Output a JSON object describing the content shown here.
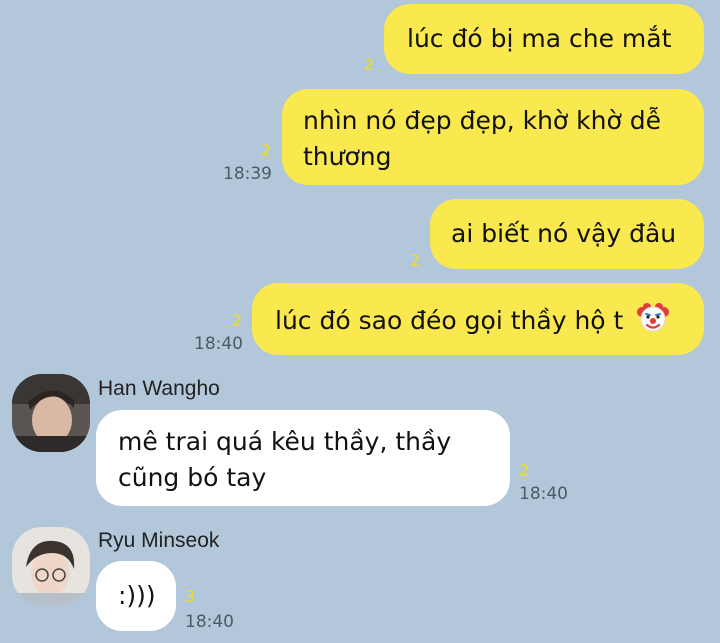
{
  "messages": [
    {
      "sender": "me",
      "text": "lúc đó bị ma che mắt",
      "unread": "2",
      "time": ""
    },
    {
      "sender": "me",
      "text_lines": [
        "nhìn nó đẹp đẹp, khờ khờ dễ",
        "thương"
      ],
      "unread": "2",
      "time": "18:39"
    },
    {
      "sender": "me",
      "text": "ai biết nó vậy đâu",
      "unread": "2",
      "time": ""
    },
    {
      "sender": "me",
      "text": "lúc đó sao đéo gọi thầy hộ t",
      "emoji": "clown-face",
      "unread": "2",
      "time": "18:40"
    },
    {
      "sender": "Han Wangho",
      "text_lines": [
        "mê trai quá kêu thầy, thầy",
        "cũng bó tay"
      ],
      "unread": "2",
      "time": "18:40"
    },
    {
      "sender": "Ryu Minseok",
      "text": ":)))",
      "unread": "3",
      "time": "18:40"
    }
  ],
  "colors": {
    "background": "#b2c7d9",
    "outgoing_bubble": "#fae84f",
    "incoming_bubble": "#ffffff",
    "unread_count": "#f1dd1b"
  }
}
